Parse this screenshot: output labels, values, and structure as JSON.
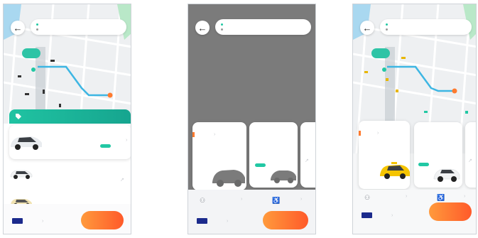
{
  "screens": [
    {
      "id": "ride-list",
      "colors": {
        "accent": "#22c8a4",
        "route": "#3db6e3",
        "cta": "#ff6a2e",
        "payment": "#1b2a8c"
      },
      "map": {
        "visible": true
      },
      "back_icon": "arrow-left-icon",
      "vehicles": [
        "sedan",
        "sedan",
        "taxi"
      ]
    },
    {
      "id": "ride-carousel-loading",
      "map": {
        "visible": false,
        "dimmed": true
      },
      "back_icon": "arrow-left-icon",
      "cards": [
        "ride-card",
        "ride-card",
        "ride-card"
      ],
      "options_icons": [
        "seat-icon",
        "wheelchair-icon"
      ]
    },
    {
      "id": "ride-carousel",
      "map": {
        "visible": true
      },
      "back_icon": "arrow-left-icon",
      "cards": [
        "taxi",
        "sedan",
        "sedan"
      ],
      "options_icons": [
        "seat-icon",
        "wheelchair-icon"
      ]
    }
  ]
}
